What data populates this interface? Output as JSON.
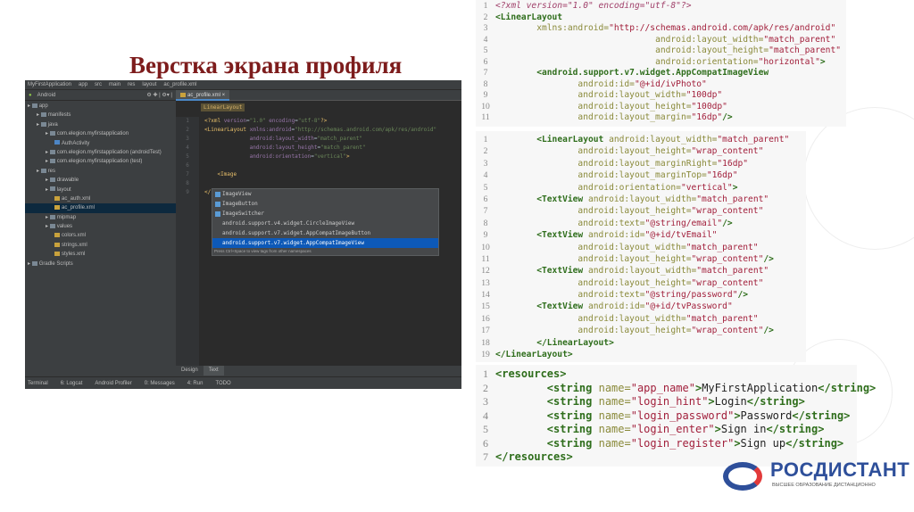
{
  "slide_title": "Верстка экрана профиля",
  "ide": {
    "breadcrumb": [
      "MyFirstApplication",
      "app",
      "src",
      "main",
      "res",
      "layout",
      "ac_profile.xml"
    ],
    "project_view": "Android",
    "tree": [
      {
        "label": "app",
        "depth": 0,
        "icon": "folder"
      },
      {
        "label": "manifests",
        "depth": 1,
        "icon": "folder"
      },
      {
        "label": "java",
        "depth": 1,
        "icon": "folder"
      },
      {
        "label": "com.elegion.myfirstapplication",
        "depth": 2,
        "icon": "package"
      },
      {
        "label": "AuthActivity",
        "depth": 3,
        "icon": "class"
      },
      {
        "label": "com.elegion.myfirstapplication (androidTest)",
        "depth": 2,
        "icon": "package"
      },
      {
        "label": "com.elegion.myfirstapplication (test)",
        "depth": 2,
        "icon": "package"
      },
      {
        "label": "res",
        "depth": 1,
        "icon": "folder"
      },
      {
        "label": "drawable",
        "depth": 2,
        "icon": "folder"
      },
      {
        "label": "layout",
        "depth": 2,
        "icon": "folder"
      },
      {
        "label": "ac_auth.xml",
        "depth": 3,
        "icon": "xml"
      },
      {
        "label": "ac_profile.xml",
        "depth": 3,
        "icon": "xml",
        "selected": true
      },
      {
        "label": "mipmap",
        "depth": 2,
        "icon": "folder"
      },
      {
        "label": "values",
        "depth": 2,
        "icon": "folder"
      },
      {
        "label": "colors.xml",
        "depth": 3,
        "icon": "xml"
      },
      {
        "label": "strings.xml",
        "depth": 3,
        "icon": "xml"
      },
      {
        "label": "styles.xml",
        "depth": 3,
        "icon": "xml"
      },
      {
        "label": "Gradle Scripts",
        "depth": 0,
        "icon": "gradle"
      }
    ],
    "editor_tab": "ac_profile.xml",
    "crumb": "LinearLayout",
    "code": [
      [
        [
          "k",
          "<?xml "
        ],
        [
          "a",
          "version"
        ],
        [
          "p",
          "="
        ],
        [
          "v",
          "\"1.0\""
        ],
        [
          "a",
          " encoding"
        ],
        [
          "p",
          "="
        ],
        [
          "v",
          "\"utf-8\""
        ],
        [
          "k",
          "?>"
        ]
      ],
      [
        [
          "k",
          "<LinearLayout "
        ],
        [
          "a",
          "xmlns:android"
        ],
        [
          "p",
          "="
        ],
        [
          "v",
          "\"http://schemas.android.com/apk/res/android\""
        ]
      ],
      [
        [
          "p",
          "              "
        ],
        [
          "a",
          "android:layout_width"
        ],
        [
          "p",
          "="
        ],
        [
          "v",
          "\"match_parent\""
        ]
      ],
      [
        [
          "p",
          "              "
        ],
        [
          "a",
          "android:layout_height"
        ],
        [
          "p",
          "="
        ],
        [
          "v",
          "\"match_parent\""
        ]
      ],
      [
        [
          "p",
          "              "
        ],
        [
          "a",
          "android:orientation"
        ],
        [
          "p",
          "="
        ],
        [
          "v",
          "\"vertical\""
        ],
        [
          "k",
          ">"
        ]
      ],
      [],
      [
        [
          "p",
          "    "
        ],
        [
          "k",
          "<Image"
        ]
      ],
      [],
      [
        [
          "k",
          "</"
        ]
      ]
    ],
    "autocomplete": [
      {
        "label": "ImageView",
        "icon": true
      },
      {
        "label": "ImageButton",
        "icon": true
      },
      {
        "label": "ImageSwitcher",
        "icon": true
      },
      {
        "label": "android.support.v4.widget.CircleImageView"
      },
      {
        "label": "android.support.v7.widget.AppCompatImageButton"
      },
      {
        "label": "android.support.v7.widget.AppCompatImageView",
        "selected": true
      }
    ],
    "autocomplete_hint": "Press Ctrl+Space to view tags from other namespaces",
    "design_tabs": [
      "Design",
      "Text"
    ],
    "status_tabs": [
      "Terminal",
      "6: Logcat",
      "Android Profiler",
      "0: Messages",
      "4: Run",
      "TODO"
    ]
  },
  "panels": [
    [
      [
        [
          "cm",
          "<?xml version=\"1.0\" encoding=\"utf-8\"?>"
        ]
      ],
      [
        [
          "t",
          "<LinearLayout"
        ]
      ],
      [
        [
          "pl",
          "        "
        ],
        [
          "at",
          "xmlns:android="
        ],
        [
          "val",
          "\"http://schemas.android.com/apk/res/android\""
        ]
      ],
      [
        [
          "pl",
          "                               "
        ],
        [
          "at",
          "android:layout_width="
        ],
        [
          "val",
          "\"match_parent\""
        ]
      ],
      [
        [
          "pl",
          "                               "
        ],
        [
          "at",
          "android:layout_height="
        ],
        [
          "val",
          "\"match_parent\""
        ]
      ],
      [
        [
          "pl",
          "                               "
        ],
        [
          "at",
          "android:orientation="
        ],
        [
          "val",
          "\"horizontal\""
        ],
        [
          "t",
          ">"
        ]
      ],
      [
        [
          "pl",
          "        "
        ],
        [
          "t",
          "<android.support.v7.widget.AppCompatImageView"
        ]
      ],
      [
        [
          "pl",
          "                "
        ],
        [
          "at",
          "android:id="
        ],
        [
          "val",
          "\"@+id/ivPhoto\""
        ]
      ],
      [
        [
          "pl",
          "                "
        ],
        [
          "at",
          "android:layout_width="
        ],
        [
          "val",
          "\"100dp\""
        ]
      ],
      [
        [
          "pl",
          "                "
        ],
        [
          "at",
          "android:layout_height="
        ],
        [
          "val",
          "\"100dp\""
        ]
      ],
      [
        [
          "pl",
          "                "
        ],
        [
          "at",
          "android:layout_margin="
        ],
        [
          "val",
          "\"16dp\""
        ],
        [
          "t",
          "/>"
        ]
      ]
    ],
    [
      [
        [
          "pl",
          "        "
        ],
        [
          "t",
          "<LinearLayout "
        ],
        [
          "at",
          "android:layout_width="
        ],
        [
          "val",
          "\"match_parent\""
        ]
      ],
      [
        [
          "pl",
          "                "
        ],
        [
          "at",
          "android:layout_height="
        ],
        [
          "val",
          "\"wrap_content\""
        ]
      ],
      [
        [
          "pl",
          "                "
        ],
        [
          "at",
          "android:layout_marginRight="
        ],
        [
          "val",
          "\"16dp\""
        ]
      ],
      [
        [
          "pl",
          "                "
        ],
        [
          "at",
          "android:layout_marginTop="
        ],
        [
          "val",
          "\"16dp\""
        ]
      ],
      [
        [
          "pl",
          "                "
        ],
        [
          "at",
          "android:orientation="
        ],
        [
          "val",
          "\"vertical\""
        ],
        [
          "t",
          ">"
        ]
      ],
      [
        [
          "pl",
          "        "
        ],
        [
          "t",
          "<TextView "
        ],
        [
          "at",
          "android:layout_width="
        ],
        [
          "val",
          "\"match_parent\""
        ]
      ],
      [
        [
          "pl",
          "                "
        ],
        [
          "at",
          "android:layout_height="
        ],
        [
          "val",
          "\"wrap_content\""
        ]
      ],
      [
        [
          "pl",
          "                "
        ],
        [
          "at",
          "android:text="
        ],
        [
          "val",
          "\"@string/email\""
        ],
        [
          "t",
          "/>"
        ]
      ],
      [
        [
          "pl",
          "        "
        ],
        [
          "t",
          "<TextView "
        ],
        [
          "at",
          "android:id="
        ],
        [
          "val",
          "\"@+id/tvEmail\""
        ]
      ],
      [
        [
          "pl",
          "                "
        ],
        [
          "at",
          "android:layout_width="
        ],
        [
          "val",
          "\"match_parent\""
        ]
      ],
      [
        [
          "pl",
          "                "
        ],
        [
          "at",
          "android:layout_height="
        ],
        [
          "val",
          "\"wrap_content\""
        ],
        [
          "t",
          "/>"
        ]
      ],
      [
        [
          "pl",
          "        "
        ],
        [
          "t",
          "<TextView "
        ],
        [
          "at",
          "android:layout_width="
        ],
        [
          "val",
          "\"match_parent\""
        ]
      ],
      [
        [
          "pl",
          "                "
        ],
        [
          "at",
          "android:layout_height="
        ],
        [
          "val",
          "\"wrap_content\""
        ]
      ],
      [
        [
          "pl",
          "                "
        ],
        [
          "at",
          "android:text="
        ],
        [
          "val",
          "\"@string/password\""
        ],
        [
          "t",
          "/>"
        ]
      ],
      [
        [
          "pl",
          "        "
        ],
        [
          "t",
          "<TextView "
        ],
        [
          "at",
          "android:id="
        ],
        [
          "val",
          "\"@+id/tvPassword\""
        ]
      ],
      [
        [
          "pl",
          "                "
        ],
        [
          "at",
          "android:layout_width="
        ],
        [
          "val",
          "\"match_parent\""
        ]
      ],
      [
        [
          "pl",
          "                "
        ],
        [
          "at",
          "android:layout_height="
        ],
        [
          "val",
          "\"wrap_content\""
        ],
        [
          "t",
          "/>"
        ]
      ],
      [
        [
          "pl",
          "        "
        ],
        [
          "t",
          "</LinearLayout>"
        ]
      ],
      [
        [
          "t",
          "</LinearLayout>"
        ]
      ]
    ],
    [
      [
        [
          "t",
          "<resources>"
        ]
      ],
      [
        [
          "pl",
          "        "
        ],
        [
          "t",
          "<string "
        ],
        [
          "at",
          "name="
        ],
        [
          "val",
          "\"app_name\""
        ],
        [
          "t",
          ">"
        ],
        [
          "pl",
          "MyFirstApplication"
        ],
        [
          "t",
          "</string>"
        ]
      ],
      [
        [
          "pl",
          "        "
        ],
        [
          "t",
          "<string "
        ],
        [
          "at",
          "name="
        ],
        [
          "val",
          "\"login_hint\""
        ],
        [
          "t",
          ">"
        ],
        [
          "pl",
          "Login"
        ],
        [
          "t",
          "</string>"
        ]
      ],
      [
        [
          "pl",
          "        "
        ],
        [
          "t",
          "<string "
        ],
        [
          "at",
          "name="
        ],
        [
          "val",
          "\"login_password\""
        ],
        [
          "t",
          ">"
        ],
        [
          "pl",
          "Password"
        ],
        [
          "t",
          "</string>"
        ]
      ],
      [
        [
          "pl",
          "        "
        ],
        [
          "t",
          "<string "
        ],
        [
          "at",
          "name="
        ],
        [
          "val",
          "\"login_enter\""
        ],
        [
          "t",
          ">"
        ],
        [
          "pl",
          "Sign in"
        ],
        [
          "t",
          "</string>"
        ]
      ],
      [
        [
          "pl",
          "        "
        ],
        [
          "t",
          "<string "
        ],
        [
          "at",
          "name="
        ],
        [
          "val",
          "\"login_register\""
        ],
        [
          "t",
          ">"
        ],
        [
          "pl",
          "Sign up"
        ],
        [
          "t",
          "</string>"
        ]
      ],
      [
        [
          "t",
          "</resources>"
        ]
      ]
    ]
  ],
  "logo": {
    "name": "РОСДИСТАНТ",
    "tagline": "ВЫСШЕЕ ОБРАЗОВАНИЕ ДИСТАНЦИОННО"
  }
}
